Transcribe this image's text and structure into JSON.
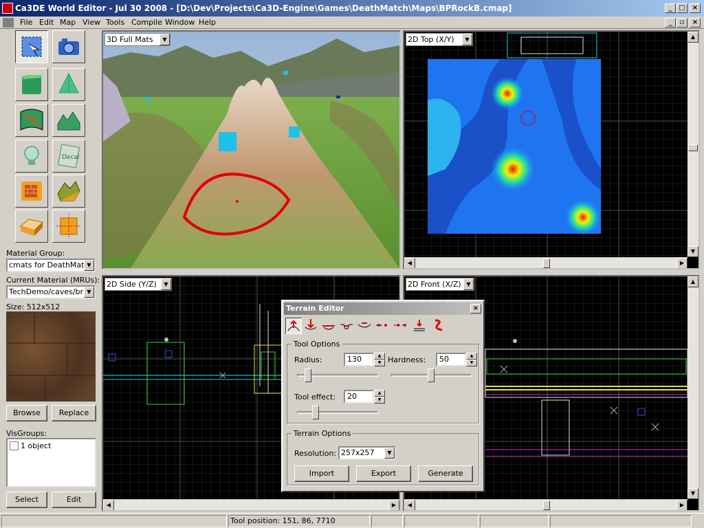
{
  "window": {
    "title": "Ca3DE World Editor - Jul 30 2008 - [D:\\Dev\\Projects\\Ca3D-Engine\\Games\\DeathMatch\\Maps\\BPRockB.cmap]",
    "min": "_",
    "max": "□",
    "close": "×"
  },
  "menu": [
    "File",
    "Edit",
    "Map",
    "View",
    "Tools",
    "Compile",
    "Window",
    "Help"
  ],
  "toolbox": {
    "material_group_label": "Material Group:",
    "material_group_value": "cmats for DeathMatch",
    "current_material_label": "Current Material (MRUs):",
    "current_material_value": "TechDemo/caves/bricks",
    "size_label": "Size: 512x512",
    "browse": "Browse",
    "replace": "Replace",
    "visgroups_label": "VisGroups:",
    "visgroups_item": "1 object",
    "select": "Select",
    "edit": "Edit"
  },
  "views": {
    "v3d": "3D Full Mats",
    "top": "2D Top (X/Y)",
    "side": "2D Side (Y/Z)",
    "front": "2D Front (X/Z)"
  },
  "terrain_editor": {
    "title": "Terrain Editor",
    "close": "×",
    "tool_options": "Tool Options",
    "radius_label": "Radius:",
    "radius_value": "130",
    "hardness_label": "Hardness:",
    "hardness_value": "50",
    "effect_label": "Tool effect:",
    "effect_value": "20",
    "terrain_options": "Terrain Options",
    "resolution_label": "Resolution:",
    "resolution_value": "257x257",
    "import": "Import",
    "export": "Export",
    "generate": "Generate",
    "sliders": {
      "radius": 0.1,
      "hardness": 0.5,
      "effect": 0.2
    }
  },
  "status": {
    "tool_position": "Tool position: 151, 86, 7710"
  },
  "colors": {
    "title_start": "#0a246a",
    "title_end": "#a6caf0",
    "brush": "#e00000"
  }
}
